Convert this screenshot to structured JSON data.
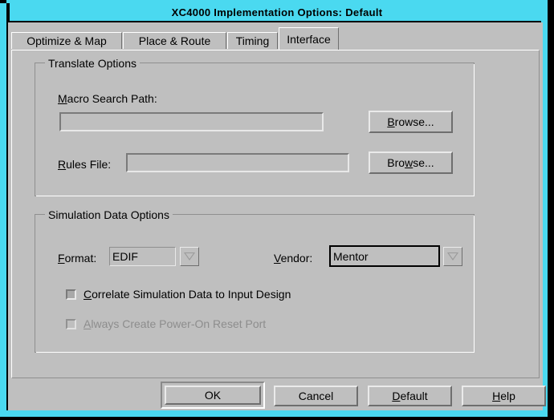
{
  "window": {
    "title": "XC4000 Implementation Options: Default",
    "titlebar_color": "#4ad9f0",
    "face_color": "#bfbfbf"
  },
  "tabs": [
    {
      "label": "Optimize & Map",
      "active": false
    },
    {
      "label": "Place & Route",
      "active": false
    },
    {
      "label": "Timing",
      "active": false
    },
    {
      "label": "Interface",
      "active": true
    }
  ],
  "translate_options": {
    "group_title": "Translate Options",
    "macro_search_path": {
      "label_pre": "M",
      "label_post": "acro Search Path:",
      "value": "",
      "browse_pre": "B",
      "browse_post": "rowse..."
    },
    "rules_file": {
      "label_pre": "R",
      "label_post": "ules File:",
      "value": "",
      "browse_a": "Bro",
      "browse_key": "w",
      "browse_b": "se..."
    }
  },
  "simulation_data_options": {
    "group_title": "Simulation Data Options",
    "format": {
      "label_pre": "F",
      "label_post": "ormat:",
      "value": "EDIF",
      "arrow_icon": "chevron-down-icon"
    },
    "vendor": {
      "label_pre": "V",
      "label_post": "endor:",
      "value": "Mentor",
      "arrow_icon": "chevron-down-icon",
      "focused": true
    },
    "correlate_checkbox": {
      "label_pre": "C",
      "label_post": "orrelate Simulation Data to Input Design",
      "checked": false,
      "enabled": true
    },
    "power_on_reset_checkbox": {
      "label_pre": "A",
      "label_post": "lways Create Power-On Reset Port",
      "checked": false,
      "enabled": false
    }
  },
  "buttons": {
    "ok": "OK",
    "cancel": "Cancel",
    "default_pre": "D",
    "default_post": "efault",
    "help_pre": "H",
    "help_post": "elp"
  }
}
